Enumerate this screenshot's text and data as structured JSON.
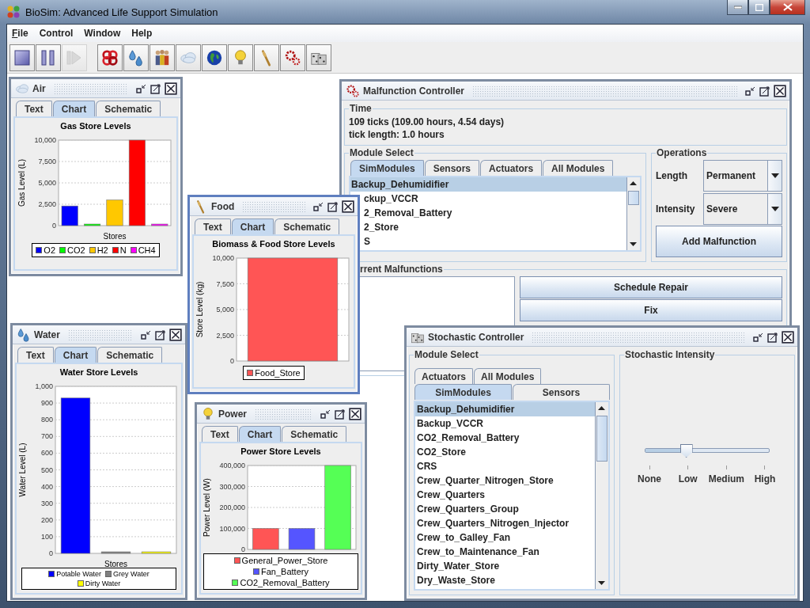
{
  "window": {
    "title": "BioSim: Advanced Life Support Simulation"
  },
  "menu": [
    {
      "label": "File",
      "mnemonic": true
    },
    {
      "label": "Control",
      "mnemonic": false
    },
    {
      "label": "Window",
      "mnemonic": false
    },
    {
      "label": "Help",
      "mnemonic": false
    }
  ],
  "toolbar": {
    "controls": [
      {
        "disabled": false
      },
      {
        "disabled": false
      },
      {
        "disabled": true
      }
    ]
  },
  "frames": [
    {
      "kind": "chart",
      "title": "Air",
      "active": false,
      "tabs": [
        {
          "label": "Text",
          "selected": false
        },
        {
          "label": "Chart",
          "selected": true
        },
        {
          "label": "Schematic",
          "selected": false
        }
      ],
      "chart_data": {
        "type": "bar",
        "stacked": false,
        "grid": true,
        "legend": "bottom",
        "title": "Gas Store Levels",
        "xlabel": "Stores",
        "ylabel": "Gas Level (L)",
        "ylim": [
          0,
          10000
        ],
        "yticks": [
          0,
          {
            "value": 2500,
            "label": "2,500"
          },
          {
            "value": 5000,
            "label": "5,000"
          },
          {
            "value": 7500,
            "label": "7,500"
          },
          {
            "value": 10000,
            "label": "10,000"
          }
        ],
        "series": [
          {
            "name": "O2",
            "color": "#0000ff",
            "values": [
              2300
            ]
          },
          {
            "name": "CO2",
            "color": "#00ff00",
            "values": [
              0
            ]
          },
          {
            "name": "H2",
            "color": "#ffc800",
            "values": [
              3000
            ]
          },
          {
            "name": "N",
            "color": "#ff0000",
            "values": [
              10000
            ]
          },
          {
            "name": "CH4",
            "color": "#ff00ff",
            "values": [
              0
            ]
          }
        ]
      }
    },
    {
      "kind": "chart",
      "title": "Water",
      "active": false,
      "tabs": [
        {
          "label": "Text",
          "selected": false
        },
        {
          "label": "Chart",
          "selected": true
        },
        {
          "label": "Schematic",
          "selected": false
        }
      ],
      "chart_data": {
        "type": "bar",
        "stacked": false,
        "grid": true,
        "legend": "bottom",
        "title": "Water Store Levels",
        "xlabel": "Stores",
        "ylabel": "Water Level (L)",
        "ylim": [
          0,
          1000
        ],
        "yticks": [
          0,
          100,
          200,
          300,
          400,
          500,
          600,
          700,
          800,
          900,
          {
            "value": 1000,
            "label": "1,000"
          }
        ],
        "series": [
          {
            "name": "Potable Water",
            "color": "#0000ff",
            "values": [
              930
            ]
          },
          {
            "name": "Grey Water",
            "color": "#808080",
            "values": [
              0
            ]
          },
          {
            "name": "Dirty Water",
            "color": "#ffff00",
            "values": [
              0
            ]
          }
        ]
      }
    },
    {
      "kind": "chart",
      "title": "Food",
      "active": true,
      "tabs": [
        {
          "label": "Text",
          "selected": false
        },
        {
          "label": "Chart",
          "selected": true
        },
        {
          "label": "Schematic",
          "selected": false
        }
      ],
      "chart_data": {
        "type": "bar",
        "stacked": false,
        "grid": true,
        "legend": "bottom",
        "title": "Biomass & Food Store Levels",
        "ylabel": "Store Level (kg)",
        "ylim": [
          0,
          10000
        ],
        "yticks": [
          0,
          {
            "value": 2500,
            "label": "2,500"
          },
          {
            "value": 5000,
            "label": "5,000"
          },
          {
            "value": 7500,
            "label": "7,500"
          },
          {
            "value": 10000,
            "label": "10,000"
          }
        ],
        "series": [
          {
            "name": "Food_Store",
            "color": "#ff5555",
            "values": [
              10000
            ]
          }
        ]
      }
    },
    {
      "kind": "chart",
      "title": "Power",
      "active": false,
      "tabs": [
        {
          "label": "Text",
          "selected": false
        },
        {
          "label": "Chart",
          "selected": true
        },
        {
          "label": "Schematic",
          "selected": false
        }
      ],
      "chart_data": {
        "type": "bar",
        "stacked": false,
        "grid": true,
        "legend": "bottom",
        "title": "Power Store Levels",
        "ylabel": "Power Level (W)",
        "ylim": [
          0,
          400000
        ],
        "yticks": [
          0,
          {
            "value": 100000,
            "label": "100,000"
          },
          {
            "value": 200000,
            "label": "200,000"
          },
          {
            "value": 300000,
            "label": "300,000"
          },
          {
            "value": 400000,
            "label": "400,000"
          }
        ],
        "series": [
          {
            "name": "General_Power_Store",
            "color": "#ff5555",
            "values": [
              100000
            ]
          },
          {
            "name": "Fan_Battery",
            "color": "#5555ff",
            "values": [
              100000
            ]
          },
          {
            "name": "CO2_Removal_Battery",
            "color": "#55ff55",
            "values": [
              400000
            ]
          }
        ]
      }
    },
    {
      "kind": "malfunction",
      "title": "Malfunction Controller",
      "active": false,
      "time": {
        "title": "Time",
        "lines": [
          "109 ticks (109.00 hours, 4.54 days)",
          "tick length: 1.0 hours"
        ]
      },
      "module_select": {
        "title": "Module Select",
        "tabs": [
          {
            "label": "SimModules",
            "selected": true
          },
          {
            "label": "Sensors",
            "selected": false
          },
          {
            "label": "Actuators",
            "selected": false
          },
          {
            "label": "All Modules",
            "selected": false
          }
        ],
        "items": [
          {
            "label": "Backup_Dehumidifier",
            "selected": true
          },
          {
            "label": "ckup_VCCR",
            "selected": false
          },
          {
            "label": "2_Removal_Battery",
            "selected": false
          },
          {
            "label": "2_Store",
            "selected": false
          },
          {
            "label": "S",
            "selected": false
          }
        ]
      },
      "operations": {
        "title": "Operations",
        "fields": [
          {
            "label": "Length",
            "value": "Permanent"
          },
          {
            "label": "Intensity",
            "value": "Severe"
          }
        ],
        "button": "Add Malfunction"
      },
      "current": {
        "title": "rrent Malfunctions",
        "buttons": [
          "Schedule Repair",
          "Fix"
        ]
      }
    },
    {
      "kind": "stochastic",
      "title": "Stochastic Controller",
      "active": false,
      "module_select": {
        "title": "Module Select",
        "tab_rows": [
          {
            "tabs": [
              {
                "label": "Actuators",
                "selected": false
              },
              {
                "label": "All Modules",
                "selected": false
              }
            ]
          },
          {
            "tabs": [
              {
                "label": "SimModules",
                "selected": true
              },
              {
                "label": "Sensors",
                "selected": false
              }
            ]
          }
        ],
        "items": [
          {
            "label": "Backup_Dehumidifier",
            "selected": true
          },
          {
            "label": "Backup_VCCR",
            "selected": false
          },
          {
            "label": "CO2_Removal_Battery",
            "selected": false
          },
          {
            "label": "CO2_Store",
            "selected": false
          },
          {
            "label": "CRS",
            "selected": false
          },
          {
            "label": "Crew_Quarter_Nitrogen_Store",
            "selected": false
          },
          {
            "label": "Crew_Quarters",
            "selected": false
          },
          {
            "label": "Crew_Quarters_Group",
            "selected": false
          },
          {
            "label": "Crew_Quarters_Nitrogen_Injector",
            "selected": false
          },
          {
            "label": "Crew_to_Galley_Fan",
            "selected": false
          },
          {
            "label": "Crew_to_Maintenance_Fan",
            "selected": false
          },
          {
            "label": "Dirty_Water_Store",
            "selected": false
          },
          {
            "label": "Dry_Waste_Store",
            "selected": false
          }
        ]
      },
      "intensity": {
        "title": "Stochastic Intensity",
        "level": 0.333,
        "labels": [
          "None",
          "Low",
          "Medium",
          "High"
        ]
      }
    }
  ]
}
